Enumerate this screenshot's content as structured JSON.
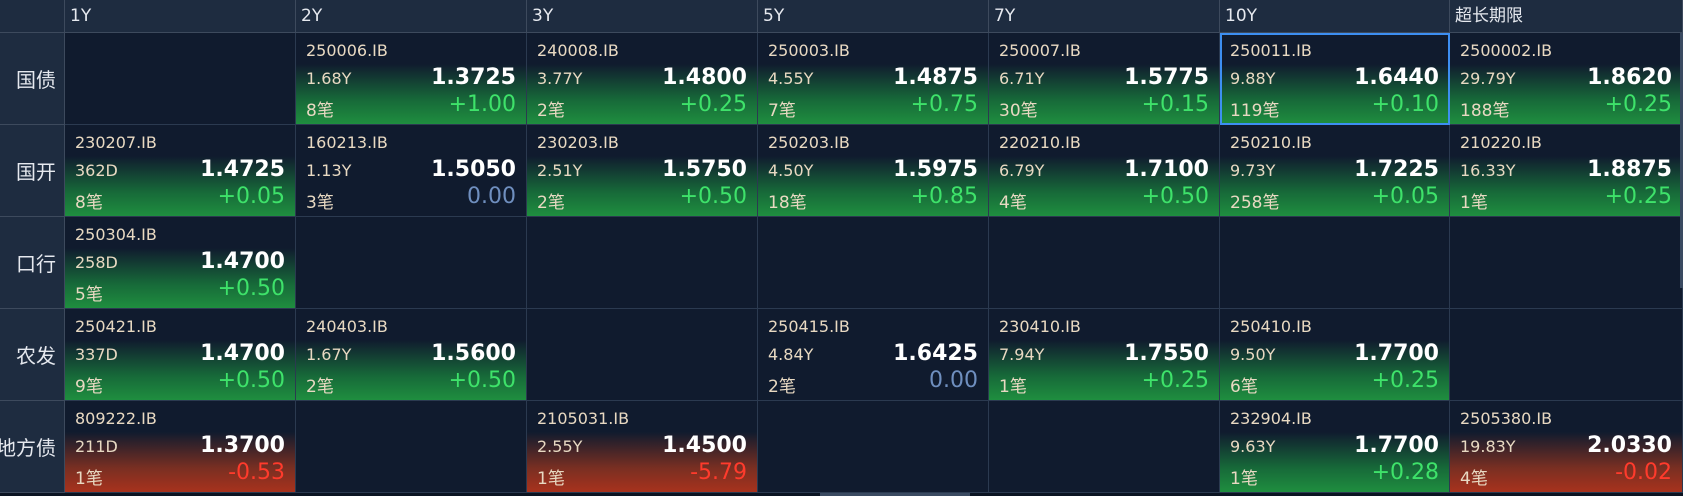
{
  "columns": [
    "1Y",
    "2Y",
    "3Y",
    "5Y",
    "7Y",
    "10Y",
    "超长期限"
  ],
  "rows": [
    {
      "label": "国债",
      "cells": [
        null,
        {
          "code": "250006.IB",
          "term": "1.68Y",
          "yield": "1.3725",
          "count": "8笔",
          "change": "+1.00",
          "trend": "up"
        },
        {
          "code": "240008.IB",
          "term": "3.77Y",
          "yield": "1.4800",
          "count": "2笔",
          "change": "+0.25",
          "trend": "up"
        },
        {
          "code": "250003.IB",
          "term": "4.55Y",
          "yield": "1.4875",
          "count": "7笔",
          "change": "+0.75",
          "trend": "up"
        },
        {
          "code": "250007.IB",
          "term": "6.71Y",
          "yield": "1.5775",
          "count": "30笔",
          "change": "+0.15",
          "trend": "up"
        },
        {
          "code": "250011.IB",
          "term": "9.88Y",
          "yield": "1.6440",
          "count": "119笔",
          "change": "+0.10",
          "trend": "up",
          "selected": true
        },
        {
          "code": "2500002.IB",
          "term": "29.79Y",
          "yield": "1.8620",
          "count": "188笔",
          "change": "+0.25",
          "trend": "up"
        }
      ]
    },
    {
      "label": "国开",
      "cells": [
        {
          "code": "230207.IB",
          "term": "362D",
          "yield": "1.4725",
          "count": "8笔",
          "change": "+0.05",
          "trend": "up"
        },
        {
          "code": "160213.IB",
          "term": "1.13Y",
          "yield": "1.5050",
          "count": "3笔",
          "change": "0.00",
          "trend": "flat"
        },
        {
          "code": "230203.IB",
          "term": "2.51Y",
          "yield": "1.5750",
          "count": "2笔",
          "change": "+0.50",
          "trend": "up"
        },
        {
          "code": "250203.IB",
          "term": "4.50Y",
          "yield": "1.5975",
          "count": "18笔",
          "change": "+0.85",
          "trend": "up"
        },
        {
          "code": "220210.IB",
          "term": "6.79Y",
          "yield": "1.7100",
          "count": "4笔",
          "change": "+0.50",
          "trend": "up"
        },
        {
          "code": "250210.IB",
          "term": "9.73Y",
          "yield": "1.7225",
          "count": "258笔",
          "change": "+0.05",
          "trend": "up"
        },
        {
          "code": "210220.IB",
          "term": "16.33Y",
          "yield": "1.8875",
          "count": "1笔",
          "change": "+0.25",
          "trend": "up"
        }
      ]
    },
    {
      "label": "口行",
      "cells": [
        {
          "code": "250304.IB",
          "term": "258D",
          "yield": "1.4700",
          "count": "5笔",
          "change": "+0.50",
          "trend": "up"
        },
        null,
        null,
        null,
        null,
        null,
        null
      ]
    },
    {
      "label": "农发",
      "cells": [
        {
          "code": "250421.IB",
          "term": "337D",
          "yield": "1.4700",
          "count": "9笔",
          "change": "+0.50",
          "trend": "up"
        },
        {
          "code": "240403.IB",
          "term": "1.67Y",
          "yield": "1.5600",
          "count": "2笔",
          "change": "+0.50",
          "trend": "up"
        },
        null,
        {
          "code": "250415.IB",
          "term": "4.84Y",
          "yield": "1.6425",
          "count": "2笔",
          "change": "0.00",
          "trend": "flat"
        },
        {
          "code": "230410.IB",
          "term": "7.94Y",
          "yield": "1.7550",
          "count": "1笔",
          "change": "+0.25",
          "trend": "up"
        },
        {
          "code": "250410.IB",
          "term": "9.50Y",
          "yield": "1.7700",
          "count": "6笔",
          "change": "+0.25",
          "trend": "up"
        },
        null
      ]
    },
    {
      "label": "地方债",
      "cells": [
        {
          "code": "809222.IB",
          "term": "211D",
          "yield": "1.3700",
          "count": "1笔",
          "change": "-0.53",
          "trend": "down"
        },
        null,
        {
          "code": "2105031.IB",
          "term": "2.55Y",
          "yield": "1.4500",
          "count": "1笔",
          "change": "-5.79",
          "trend": "down"
        },
        null,
        null,
        {
          "code": "232904.IB",
          "term": "9.63Y",
          "yield": "1.7700",
          "count": "1笔",
          "change": "+0.28",
          "trend": "up"
        },
        {
          "code": "2505380.IB",
          "term": "19.83Y",
          "yield": "2.0330",
          "count": "4笔",
          "change": "-0.02",
          "trend": "down"
        }
      ]
    }
  ]
}
